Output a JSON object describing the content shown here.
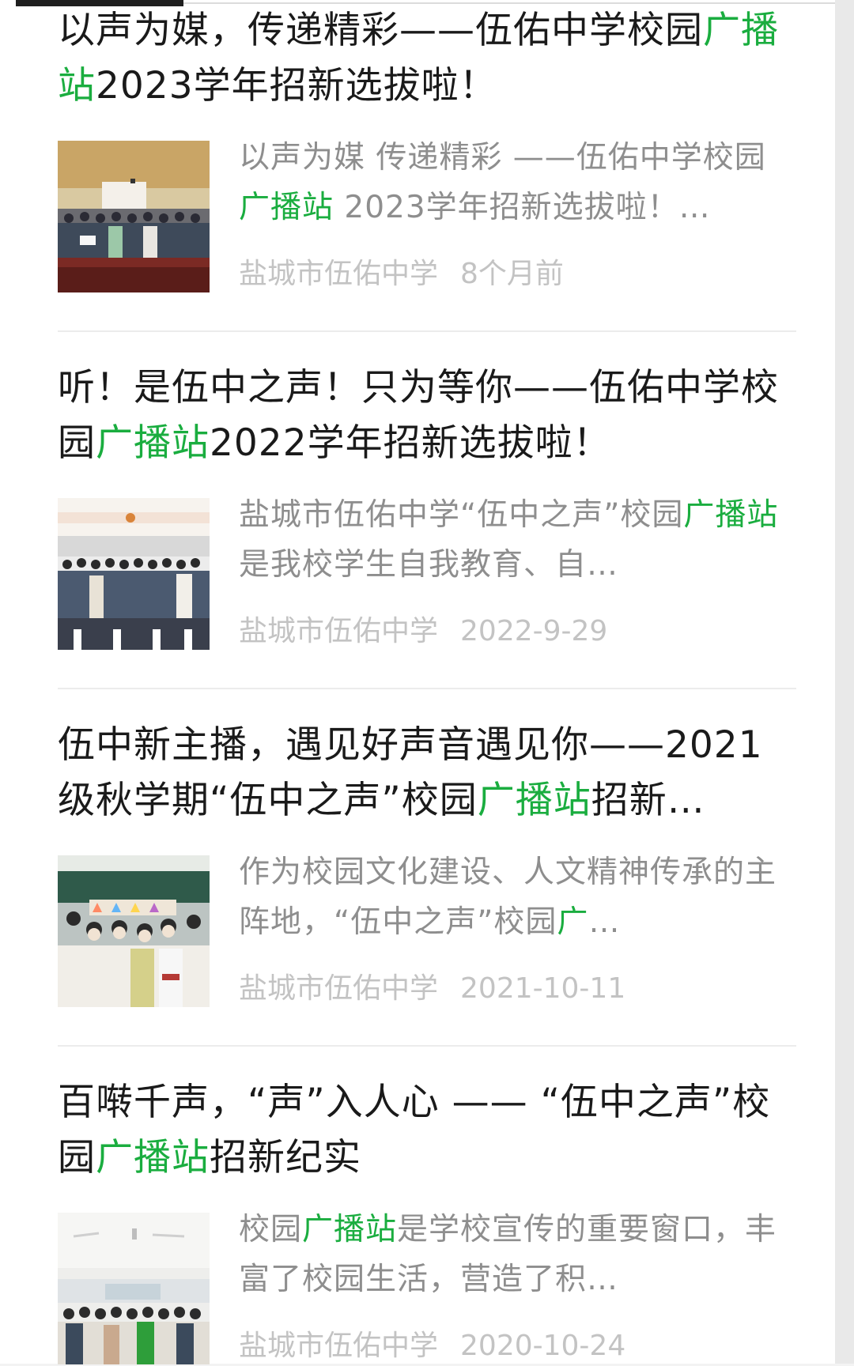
{
  "results": [
    {
      "title_parts": [
        "以声为媒，传递精彩——伍佑中学校园",
        "广播站",
        "2023学年招新选拔啦！"
      ],
      "summary_parts": [
        "以声为媒 传递精彩 ——伍佑中学校园",
        "广播站",
        " 2023学年招新选拔啦！…"
      ],
      "source": "盐城市伍佑中学",
      "date": "8个月前"
    },
    {
      "title_parts": [
        "听！是伍中之声！只为等你——伍佑中学校园",
        "广播站",
        "2022学年招新选拔啦！"
      ],
      "summary_parts": [
        "盐城市伍佑中学“伍中之声”校园",
        "广播站",
        "是我校学生自我教育、自…"
      ],
      "source": "盐城市伍佑中学",
      "date": "2022-9-29"
    },
    {
      "title_parts": [
        "伍中新主播，遇见好声音遇见你——2021级秋学期“伍中之声”校园",
        "广播站",
        "招新…"
      ],
      "summary_parts": [
        "作为校园文化建设、人文精神传承的主阵地，“伍中之声”校园",
        "广",
        "…"
      ],
      "source": "盐城市伍佑中学",
      "date": "2021-10-11"
    },
    {
      "title_parts": [
        "百啭千声，“声”入人心 —— “伍中之声”校园",
        "广播站",
        "招新纪实"
      ],
      "summary_parts": [
        "校园",
        "广播站",
        "是学校宣传的重要窗口，丰富了校园生活，营造了积…"
      ],
      "source": "盐城市伍佑中学",
      "date": "2020-10-24"
    }
  ],
  "highlight_color": "#1aad3f"
}
